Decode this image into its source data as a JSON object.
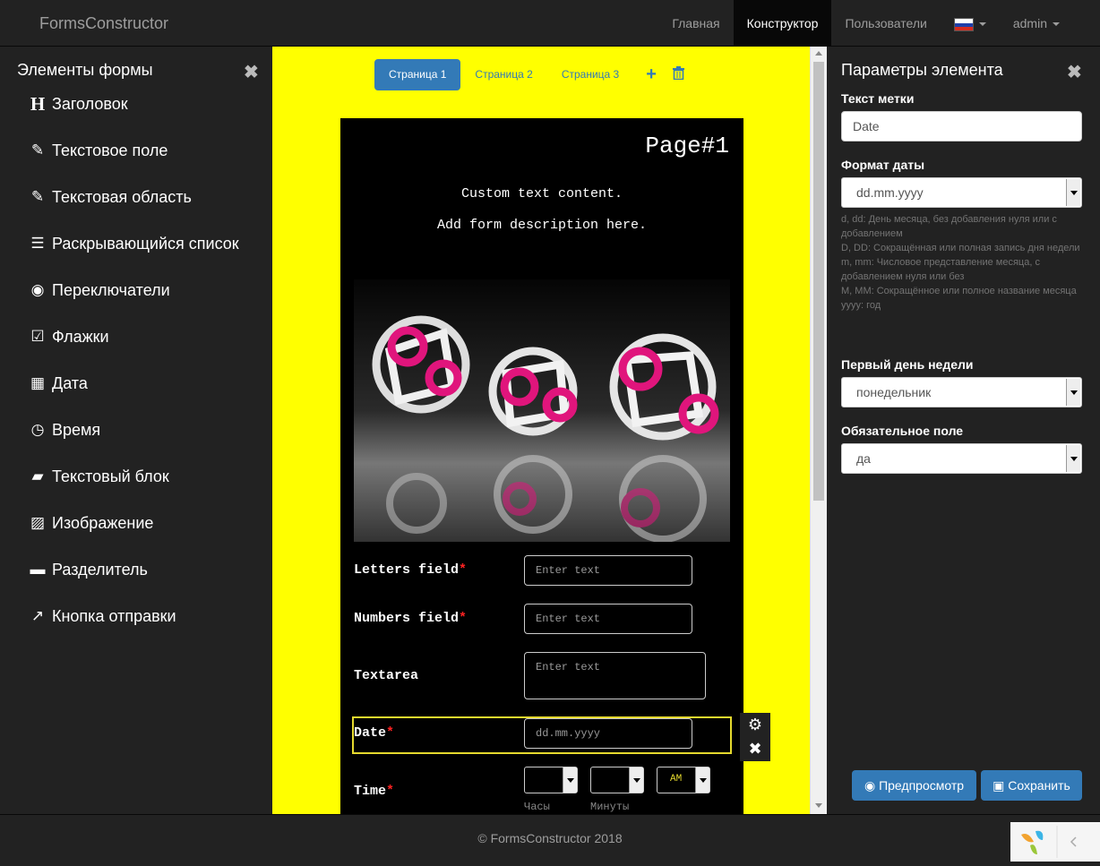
{
  "nav": {
    "brand": "FormsConstructor",
    "items": [
      {
        "label": "Главная"
      },
      {
        "label": "Конструктор",
        "active": true
      },
      {
        "label": "Пользователи"
      }
    ],
    "language_icon": "russian-flag-icon",
    "user": "admin"
  },
  "left_panel": {
    "title": "Элементы формы",
    "items": [
      {
        "icon": "heading-icon",
        "glyph": "H",
        "label": "Заголовок"
      },
      {
        "icon": "edit-icon",
        "glyph": "✎",
        "label": "Текстовое поле"
      },
      {
        "icon": "edit-icon",
        "glyph": "✎",
        "label": "Текстовая область"
      },
      {
        "icon": "list-icon",
        "glyph": "☰",
        "label": "Раскрывающийся список"
      },
      {
        "icon": "radio-icon",
        "glyph": "◉",
        "label": "Переключатели"
      },
      {
        "icon": "checkbox-icon",
        "glyph": "☑",
        "label": "Флажки"
      },
      {
        "icon": "calendar-icon",
        "glyph": "▦",
        "label": "Дата"
      },
      {
        "icon": "clock-icon",
        "glyph": "◷",
        "label": "Время"
      },
      {
        "icon": "comment-icon",
        "glyph": "▰",
        "label": "Текстовый блок"
      },
      {
        "icon": "picture-icon",
        "glyph": "▨",
        "label": "Изображение"
      },
      {
        "icon": "minus-icon",
        "glyph": "▬",
        "label": "Разделитель"
      },
      {
        "icon": "share-icon",
        "glyph": "↗",
        "label": "Кнопка отправки"
      }
    ]
  },
  "page_tabs": {
    "tabs": [
      {
        "label": "Страница 1",
        "active": true
      },
      {
        "label": "Страница 2"
      },
      {
        "label": "Страница 3"
      }
    ],
    "add_icon": "plus-icon",
    "delete_icon": "trash-icon"
  },
  "form": {
    "page_title": "Page#1",
    "description_line1": "Custom text content.",
    "description_line2": "Add form description here.",
    "fields": {
      "letters_label": "Letters field",
      "letters_placeholder": "Enter text",
      "numbers_label": "Numbers field",
      "numbers_placeholder": "Enter text",
      "textarea_label": "Textarea",
      "textarea_placeholder": "Enter text",
      "date_label": "Date",
      "date_placeholder": "dd.mm.yyyy",
      "time_label": "Time",
      "time_ampm": "AM",
      "time_hours_label": "Часы",
      "time_minutes_label": "Минуты",
      "required_mark": "*"
    }
  },
  "right_panel": {
    "title": "Параметры элемента",
    "label_text_title": "Текст метки",
    "label_text_value": "Date",
    "date_format_title": "Формат даты",
    "date_format_value": "dd.mm.yyyy",
    "help_lines": [
      "d, dd: День месяца, без добавления нуля или с добавлением",
      "D, DD: Сокращённая или полная запись дня недели",
      "m, mm: Числовое представление месяца, с добавлением нуля или без",
      "M, MM: Сокращённое или полное название месяца",
      "yyyy: год"
    ],
    "first_day_title": "Первый день недели",
    "first_day_value": "понедельник",
    "required_title": "Обязательное поле",
    "required_value": "да",
    "preview_button": "Предпросмотр",
    "save_button": "Сохранить"
  },
  "footer": {
    "text": "© FormsConstructor 2018"
  },
  "colors": {
    "accent": "#337ab7",
    "canvas": "#ffff00",
    "selected_border": "#e5d92e",
    "required": "#ff2222"
  }
}
